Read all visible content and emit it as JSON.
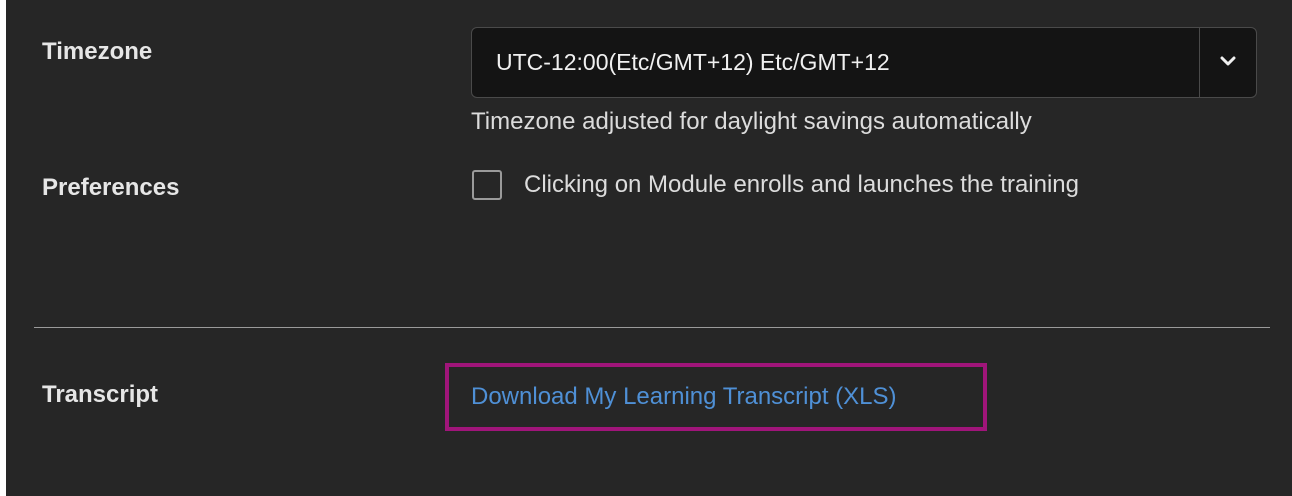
{
  "timezone": {
    "label": "Timezone",
    "selected_value": "UTC-12:00(Etc/GMT+12) Etc/GMT+12",
    "dropdown_icon": "chevron-down-icon",
    "helper_text": "Timezone adjusted for daylight savings automatically"
  },
  "preferences": {
    "label": "Preferences",
    "checkbox_label": "Clicking on Module enrolls and launches the training",
    "checked": false
  },
  "transcript": {
    "label": "Transcript",
    "link_text": "Download My Learning Transcript (XLS)"
  },
  "colors": {
    "background": "#262626",
    "link": "#4f90d6",
    "highlight_border": "#a0157a"
  }
}
